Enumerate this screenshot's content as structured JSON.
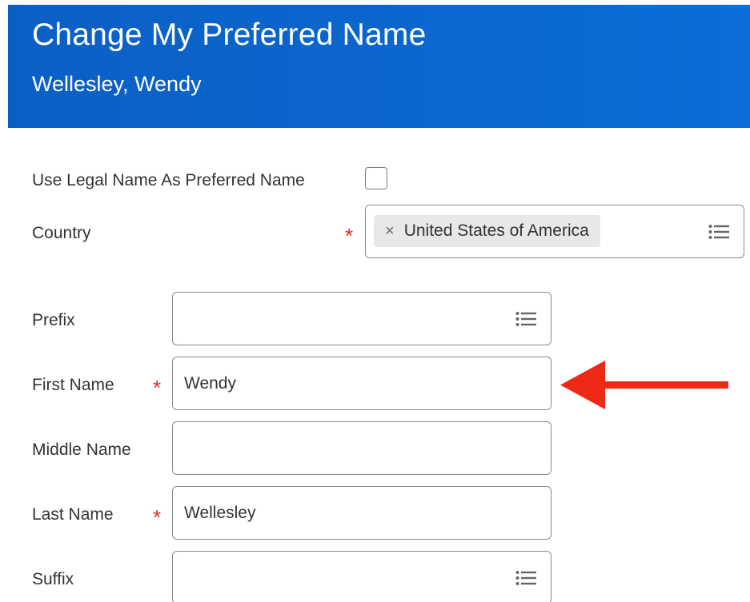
{
  "header": {
    "title": "Change My Preferred Name",
    "subtitle": "Wellesley, Wendy",
    "background_color": "#0a62c8"
  },
  "form": {
    "use_legal_name": {
      "label": "Use Legal Name As Preferred Name",
      "checked": false
    },
    "country": {
      "label": "Country",
      "required_mark": "*",
      "selected_value": "United States of America",
      "remove_glyph": "×",
      "icon": "list-icon"
    },
    "prefix": {
      "label": "Prefix",
      "value": "",
      "icon": "list-icon"
    },
    "first_name": {
      "label": "First Name",
      "required_mark": "*",
      "value": "Wendy"
    },
    "middle_name": {
      "label": "Middle Name",
      "value": ""
    },
    "last_name": {
      "label": "Last Name",
      "required_mark": "*",
      "value": "Wellesley"
    },
    "suffix": {
      "label": "Suffix",
      "value": "",
      "icon": "list-icon"
    }
  },
  "annotation": {
    "type": "arrow-pointing-left",
    "color": "#ee2a16"
  },
  "colors": {
    "required": "#de2e21",
    "border": "#8a8a8a",
    "text": "#333333"
  }
}
